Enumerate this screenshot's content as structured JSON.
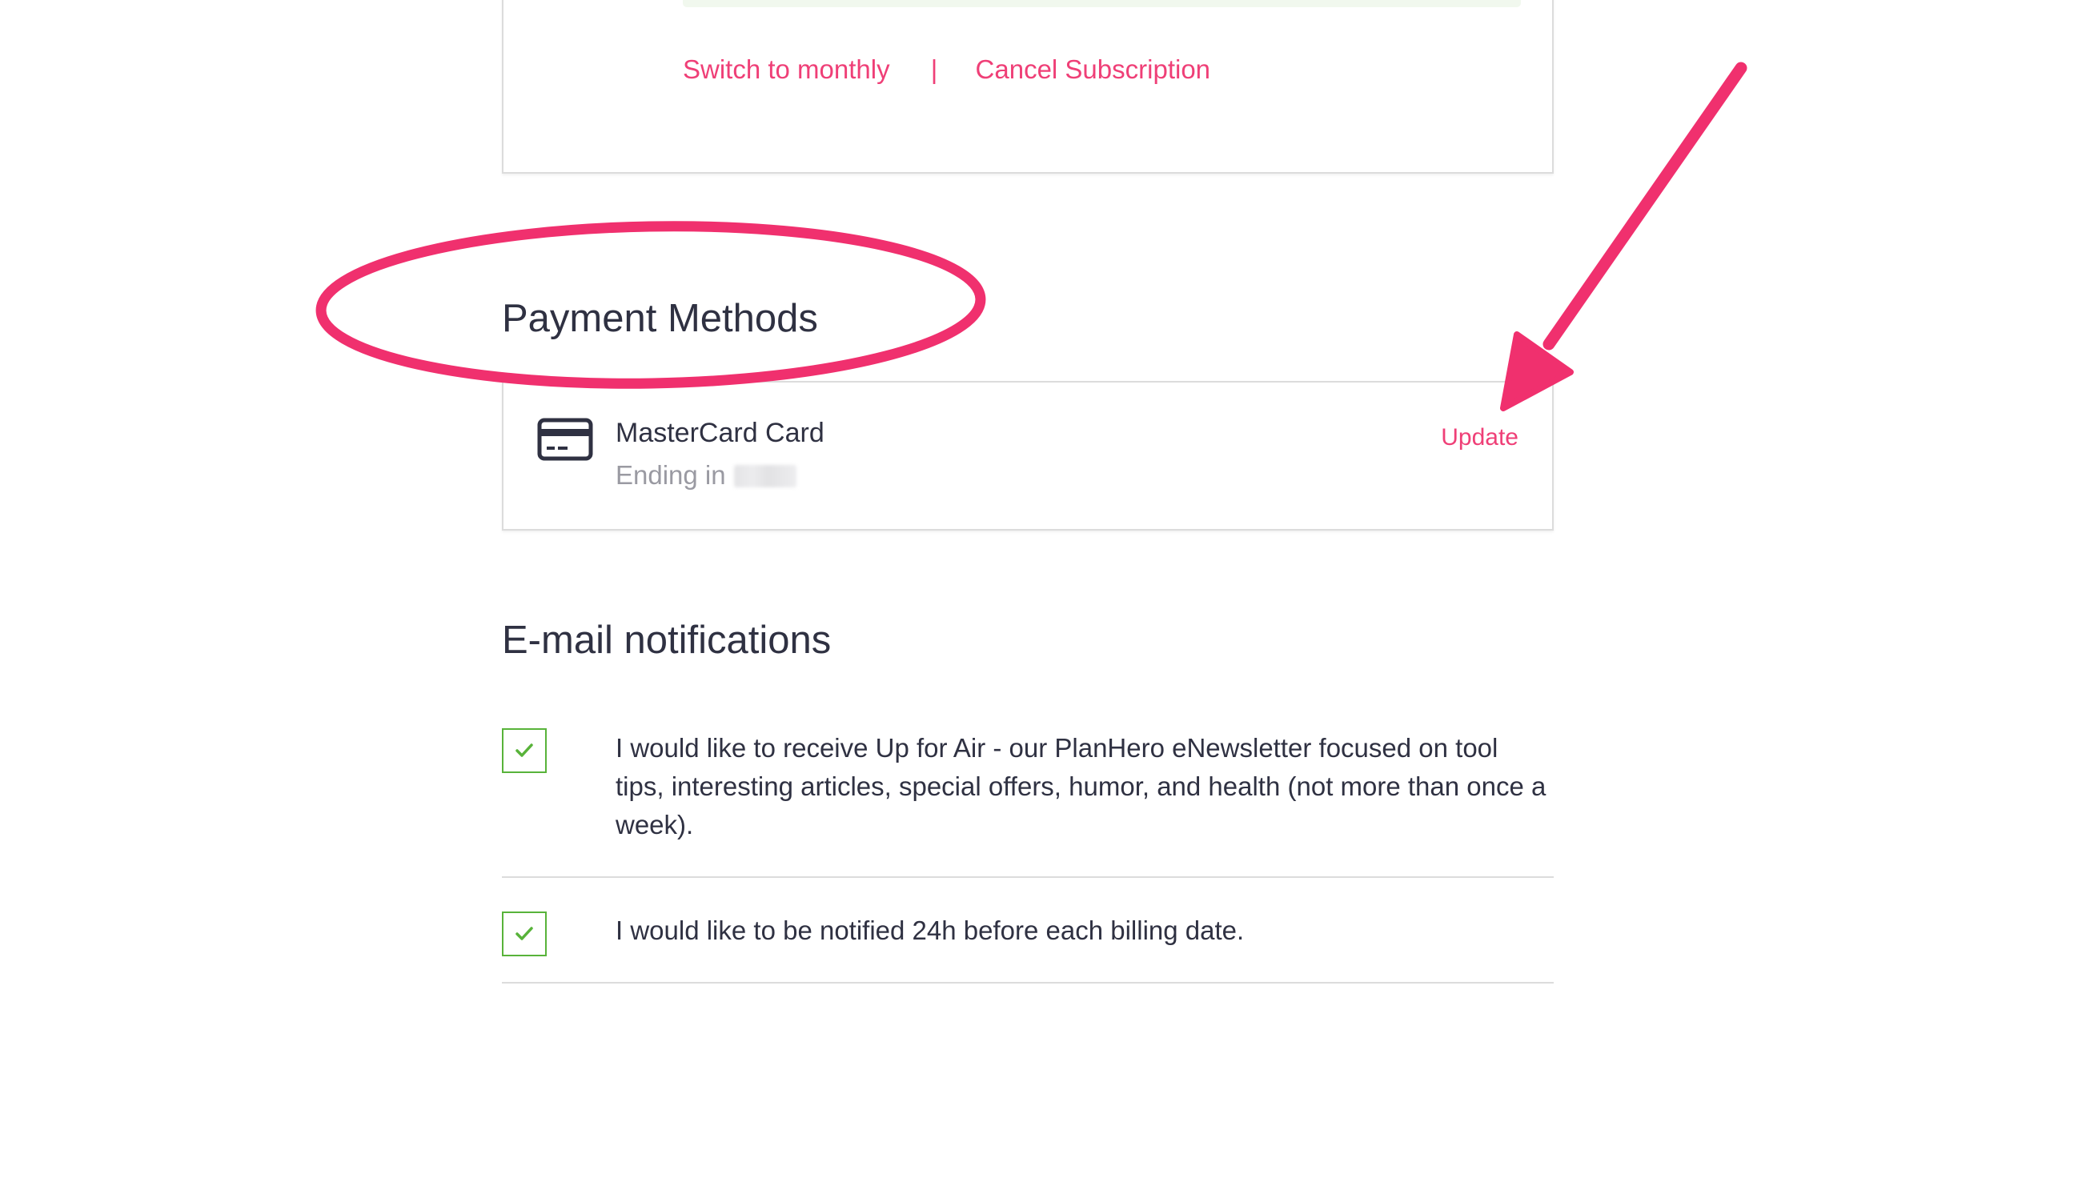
{
  "subscription": {
    "switch_label": "Switch to monthly",
    "separator": "|",
    "cancel_label": "Cancel Subscription"
  },
  "payment": {
    "title": "Payment Methods",
    "card_icon": "credit-card-icon",
    "card_name": "MasterCard Card",
    "ending_label": "Ending in",
    "update_label": "Update"
  },
  "email": {
    "title": "E-mail notifications",
    "options": [
      {
        "checked": true,
        "text": "I would like to receive Up for Air - our PlanHero eNewsletter focused on tool tips, interesting articles, special offers, humor, and health (not more than once a week)."
      },
      {
        "checked": true,
        "text": "I would like to be notified 24h before each billing date."
      }
    ]
  },
  "colors": {
    "accent": "#ef3f77",
    "annotation": "#f0306e",
    "checkbox": "#58b33a",
    "text": "#2f3142",
    "muted": "#9a9aa2",
    "border": "#dcdcdc"
  },
  "annotations": {
    "ellipse_target": "Payment Methods heading",
    "arrow_target": "Update link"
  }
}
